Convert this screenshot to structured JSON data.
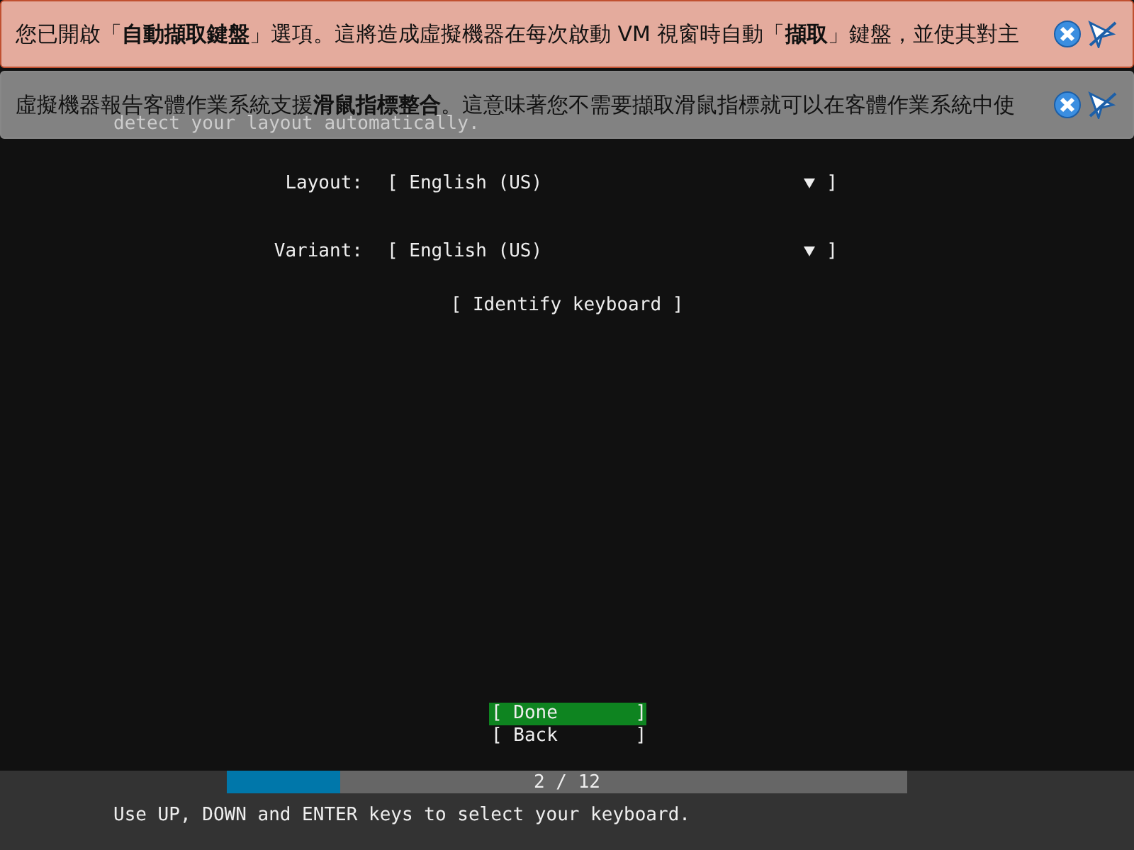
{
  "notifications": [
    {
      "kind": "warning",
      "text": "您已開啟「**自動擷取鍵盤**」選項。這將造成虛擬機器在每次啟動 VM 視窗時自動「**擷取**」鍵盤，並使其對主"
    },
    {
      "kind": "info",
      "text": "虛擬機器報告客體作業系統支援**滑鼠指標整合**。這意味著您不需要擷取滑鼠指標就可以在客體作業系統中使"
    }
  ],
  "intro": "detect your layout automatically.",
  "fields": [
    {
      "label": "Layout:",
      "value": "[ English (US)",
      "close": "]"
    },
    {
      "label": "Variant:",
      "value": "[ English (US)",
      "close": "]"
    }
  ],
  "identify_button": "[ Identify keyboard ]",
  "buttons": [
    {
      "label": "[ Done       ]",
      "selected": true
    },
    {
      "label": "[ Back       ]",
      "selected": false
    }
  ],
  "progress": {
    "level": 0.1667,
    "text": "2 / 12"
  },
  "status_bar": "Use UP, DOWN and ENTER keys to select your keyboard."
}
